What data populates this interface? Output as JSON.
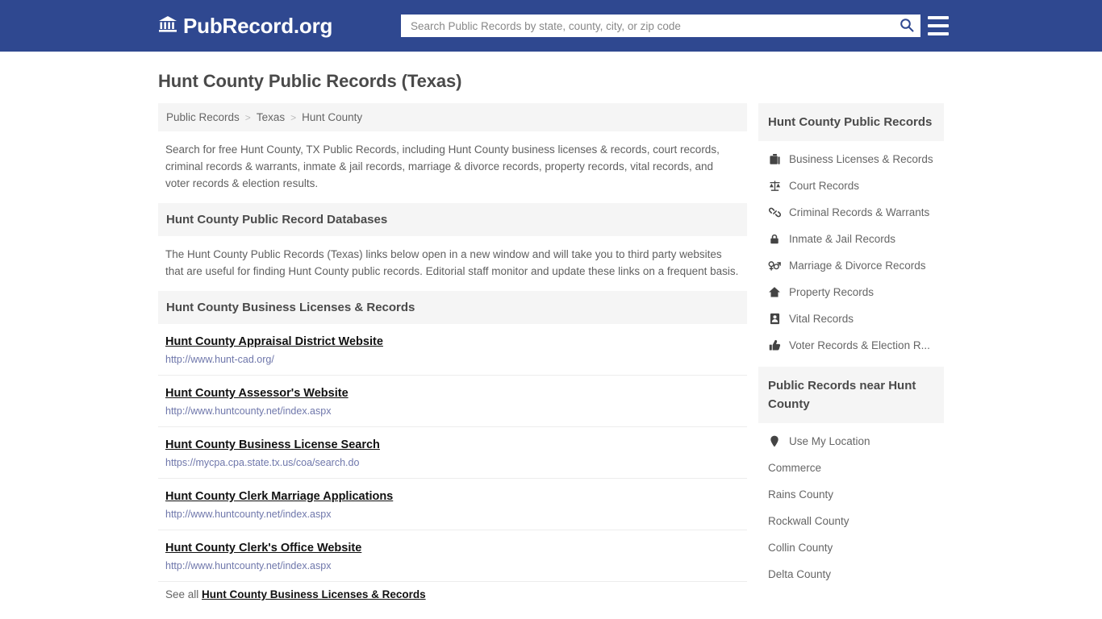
{
  "header": {
    "brand_text": "PubRecord.org",
    "brand_icon": "bank-icon",
    "search": {
      "placeholder": "Search Public Records by state, county, city, or zip code",
      "value": "",
      "icon": "search-icon"
    },
    "menu_icon": "hamburger-menu-icon",
    "bg_color": "#2f4890"
  },
  "page": {
    "title": "Hunt County Public Records (Texas)"
  },
  "breadcrumb": {
    "separator": ">",
    "items": [
      {
        "label": "Public Records"
      },
      {
        "label": "Texas"
      },
      {
        "label": "Hunt County"
      }
    ]
  },
  "intro": {
    "text": "Search for free Hunt County, TX Public Records, including Hunt County business licenses & records, court records, criminal records & warrants, inmate & jail records, marriage & divorce records, property records, vital records, and voter records & election results."
  },
  "databases_section": {
    "heading": "Hunt County Public Record Databases",
    "text": "The Hunt County Public Records (Texas) links below open in a new window and will take you to third party websites that are useful for finding Hunt County public records. Editorial staff monitor and update these links on a frequent basis."
  },
  "business_section": {
    "heading": "Hunt County Business Licenses & Records",
    "links": [
      {
        "title": "Hunt County Appraisal District Website",
        "url": "http://www.hunt-cad.org/"
      },
      {
        "title": "Hunt County Assessor's Website",
        "url": "http://www.huntcounty.net/index.aspx"
      },
      {
        "title": "Hunt County Business License Search",
        "url": "https://mycpa.cpa.state.tx.us/coa/search.do"
      },
      {
        "title": "Hunt County Clerk Marriage Applications",
        "url": "http://www.huntcounty.net/index.aspx"
      },
      {
        "title": "Hunt County Clerk's Office Website",
        "url": "http://www.huntcounty.net/index.aspx"
      }
    ],
    "see_all_prefix": "See all",
    "see_all_link": "Hunt County Business Licenses & Records"
  },
  "sidebar": {
    "records_panel": {
      "heading": "Hunt County Public Records",
      "items": [
        {
          "label": "Business Licenses & Records",
          "icon": "briefcase-icon"
        },
        {
          "label": "Court Records",
          "icon": "scales-icon"
        },
        {
          "label": "Criminal Records & Warrants",
          "icon": "handcuffs-icon"
        },
        {
          "label": "Inmate & Jail Records",
          "icon": "lock-icon"
        },
        {
          "label": "Marriage & Divorce Records",
          "icon": "venus-mars-icon"
        },
        {
          "label": "Property Records",
          "icon": "home-icon"
        },
        {
          "label": "Vital Records",
          "icon": "id-card-icon"
        },
        {
          "label": "Voter Records & Election R...",
          "icon": "thumbs-up-icon"
        }
      ]
    },
    "nearby_panel": {
      "heading": "Public Records near Hunt County",
      "items": [
        {
          "label": "Use My Location",
          "icon": "map-pin-icon"
        },
        {
          "label": "Commerce",
          "icon": ""
        },
        {
          "label": "Rains County",
          "icon": ""
        },
        {
          "label": "Rockwall County",
          "icon": ""
        },
        {
          "label": "Collin County",
          "icon": ""
        },
        {
          "label": "Delta County",
          "icon": ""
        }
      ]
    }
  }
}
